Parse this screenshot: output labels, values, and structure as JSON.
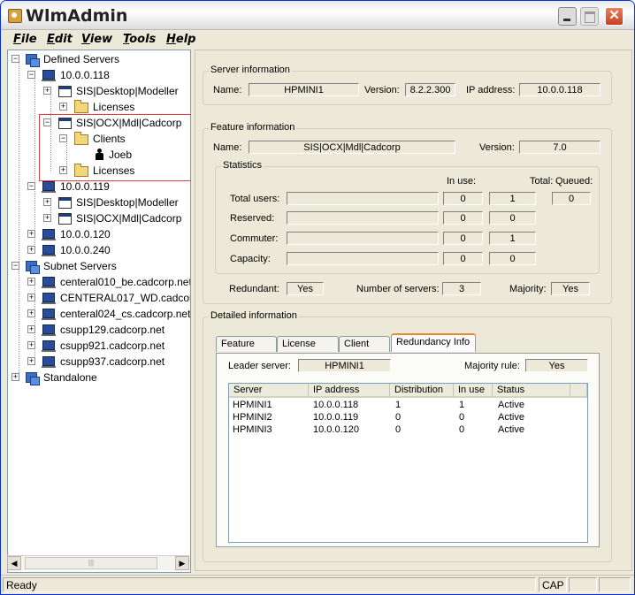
{
  "window": {
    "title": "WlmAdmin"
  },
  "menu": [
    {
      "label": "File",
      "key": "F",
      "rest": "ile"
    },
    {
      "label": "Edit",
      "key": "E",
      "rest": "dit"
    },
    {
      "label": "View",
      "key": "V",
      "rest": "iew"
    },
    {
      "label": "Tools",
      "key": "T",
      "rest": "ools"
    },
    {
      "label": "Help",
      "key": "H",
      "rest": "elp"
    }
  ],
  "tree": {
    "defined_servers": "Defined Servers",
    "server_1": "10.0.0.118",
    "feature_1": "SIS|Desktop|Modeller",
    "licenses_1": "Licenses",
    "feature_2": "SIS|OCX|Mdl|Cadcorp",
    "clients": "Clients",
    "client_user": "Joeb",
    "licenses_2": "Licenses",
    "server_2": "10.0.0.119",
    "feature_3": "SIS|Desktop|Modeller",
    "feature_4": "SIS|OCX|Mdl|Cadcorp",
    "server_3": "10.0.0.120",
    "server_4": "10.0.0.240",
    "subnet_servers": "Subnet Servers",
    "subnet_1": "centeral010_be.cadcorp.net",
    "subnet_2": "CENTERAL017_WD.cadcorp.net",
    "subnet_3": "centeral024_cs.cadcorp.net",
    "subnet_4": "csupp129.cadcorp.net",
    "subnet_5": "csupp921.cadcorp.net",
    "subnet_6": "csupp937.cadcorp.net",
    "standalone": "Standalone"
  },
  "server_info": {
    "title": "Server information",
    "name_label": "Name:",
    "name": "HPMINI1",
    "version_label": "Version:",
    "version": "8.2.2.300",
    "ip_label": "IP address:",
    "ip": "10.0.0.118"
  },
  "feature_info": {
    "title": "Feature information",
    "name_label": "Name:",
    "name": "SIS|OCX|Mdl|Cadcorp",
    "version_label": "Version:",
    "version": "7.0",
    "statistics": {
      "title": "Statistics",
      "col_in_use": "In use:",
      "col_total": "Total:",
      "col_queued": "Queued:",
      "rows": [
        {
          "label": "Total users:",
          "in_use": "0",
          "total": "1",
          "queued": "0"
        },
        {
          "label": "Reserved:",
          "in_use": "0",
          "total": "0"
        },
        {
          "label": "Commuter:",
          "in_use": "0",
          "total": "1"
        },
        {
          "label": "Capacity:",
          "in_use": "0",
          "total": "0"
        }
      ]
    },
    "redundant_label": "Redundant:",
    "redundant": "Yes",
    "num_servers_label": "Number of servers:",
    "num_servers": "3",
    "majority_label": "Majority:",
    "majority": "Yes"
  },
  "detailed": {
    "title": "Detailed information",
    "tabs": [
      "Feature Info",
      "License Info",
      "Client Info",
      "Redundancy Info"
    ],
    "leader_label": "Leader server:",
    "leader": "HPMINI1",
    "majority_rule_label": "Majority rule:",
    "majority_rule": "Yes",
    "columns": [
      "Server",
      "IP address",
      "Distribution",
      "In use",
      "Status"
    ],
    "rows": [
      {
        "server": "HPMINI1",
        "ip": "10.0.0.118",
        "distribution": "1",
        "in_use": "1",
        "status": "Active"
      },
      {
        "server": "HPMINI2",
        "ip": "10.0.0.119",
        "distribution": "0",
        "in_use": "0",
        "status": "Active"
      },
      {
        "server": "HPMINI3",
        "ip": "10.0.0.120",
        "distribution": "0",
        "in_use": "0",
        "status": "Active"
      }
    ]
  },
  "status": {
    "text": "Ready",
    "cap": "CAP"
  }
}
